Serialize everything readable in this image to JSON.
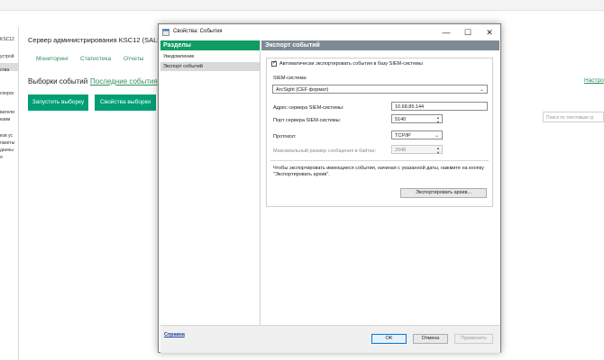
{
  "background": {
    "left_items": [
      "KSC12",
      "устрой",
      "ства",
      "сперск",
      "ватели",
      "ками",
      "ков ус",
      "пакеты",
      "данны",
      "я"
    ],
    "console_title": "Сервер администрирования KSC12 (SALES",
    "tabs": [
      "Мониторинг",
      "Статистика",
      "Отчеты"
    ],
    "section_title": "Выборки событий",
    "recent_events_link": "Последние события",
    "run_selection_button": "Запустить выборку",
    "selection_props_button": "Свойства выборки",
    "search_placeholder": "Поиск по текстовым гр",
    "right_link": "Настро"
  },
  "dialog": {
    "title": "Свойства: События",
    "window_controls": {
      "minimize": "—",
      "maximize": "☐",
      "close": "✕"
    },
    "nav": {
      "header": "Разделы",
      "items": [
        "Уведомление",
        "Экспорт событий"
      ],
      "selected_index": 1
    },
    "panel": {
      "header": "Экспорт событий",
      "auto_export_checkbox": {
        "label": "Автоматически экспортировать события в базу SIEM-системы",
        "checked": true
      },
      "siem_label": "SIEM-система:",
      "siem_value": "ArcSight (CEF формат)",
      "server_address_label": "Адрес сервера SIEM-системы:",
      "server_address_value": "10.68.85.144",
      "server_port_label": "Порт сервера SIEM-системы:",
      "server_port_value": "5140",
      "protocol_label": "Протокол:",
      "protocol_value": "TCP/IP",
      "max_size_label": "Максимальный размер сообщения в байтах:",
      "max_size_value": "2048",
      "archive_note": "Чтобы экспортировать имеющиеся события, начиная с указанной даты, нажмите на кнопку \"Экспортировать архив\".",
      "export_archive_button": "Экспортировать архив..."
    },
    "footer": {
      "help_link": "Справка",
      "ok": "OK",
      "cancel": "Отмена",
      "apply": "Применить"
    }
  }
}
